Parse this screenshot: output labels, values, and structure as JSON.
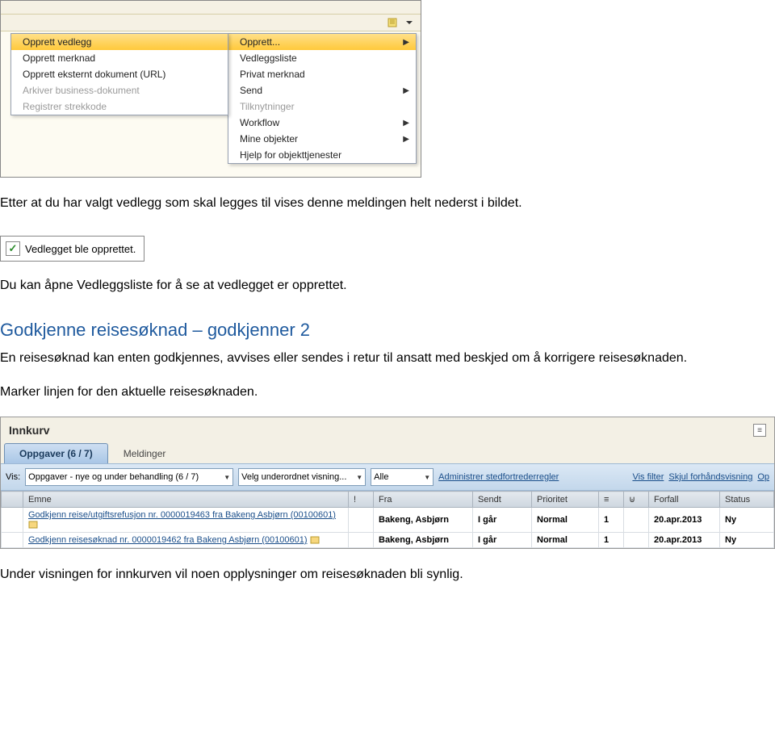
{
  "context_menu_left": {
    "items": [
      {
        "label": "Opprett vedlegg",
        "enabled": true,
        "highlight": true
      },
      {
        "label": "Opprett merknad",
        "enabled": true
      },
      {
        "label": "Opprett eksternt dokument (URL)",
        "enabled": true
      },
      {
        "label": "Arkiver business-dokument",
        "enabled": false
      },
      {
        "label": "Registrer strekkode",
        "enabled": false
      }
    ]
  },
  "context_menu_right": {
    "items": [
      {
        "label": "Opprett...",
        "enabled": true,
        "submenu": true,
        "highlight": true
      },
      {
        "label": "Vedleggsliste",
        "enabled": true
      },
      {
        "label": "Privat merknad",
        "enabled": true
      },
      {
        "label": "Send",
        "enabled": true,
        "submenu": true
      },
      {
        "label": "Tilknytninger",
        "enabled": false
      },
      {
        "label": "Workflow",
        "enabled": true,
        "submenu": true
      },
      {
        "label": "Mine objekter",
        "enabled": true,
        "submenu": true
      },
      {
        "label": "Hjelp for objekttjenester",
        "enabled": true
      }
    ]
  },
  "status_message": {
    "text": "Vedlegget ble opprettet."
  },
  "body_text": {
    "after_menu": "Etter at du har valgt vedlegg som skal legges til vises denne meldingen helt nederst i bildet.",
    "after_status": "Du kan åpne Vedleggsliste for å se at vedlegget er opprettet.",
    "heading": "Godkjenne reisesøknad – godkjenner 2",
    "p1": "En reisesøknad kan enten godkjennes, avvises eller sendes i retur til ansatt med beskjed om å korrigere reisesøknaden.",
    "p2": "Marker linjen for den aktuelle reisesøknaden.",
    "after_innkurv": "Under visningen for innkurven vil noen opplysninger om reisesøknaden bli synlig."
  },
  "innkurv": {
    "title": "Innkurv",
    "tabs": [
      {
        "label": "Oppgaver  (6 / 7)",
        "active": true
      },
      {
        "label": "Meldinger"
      }
    ],
    "filter": {
      "vis_label": "Vis:",
      "select1": "Oppgaver - nye og under behandling  (6 / 7)",
      "select2": "Velg underordnet visning...",
      "select3": "Alle",
      "link1": "Administrer stedfortrederregler",
      "link2": "Vis filter",
      "link3": "Skjul forhåndsvisning",
      "link4": "Op"
    },
    "columns": [
      "Emne",
      "!",
      "Fra",
      "Sendt",
      "Prioritet",
      "≡",
      "⊍",
      "Forfall",
      "Status"
    ],
    "rows": [
      {
        "emne": "Godkjenn reise/utgiftsrefusjon nr. 0000019463 fra Bakeng Asbjørn (00100601)",
        "fra": "Bakeng, Asbjørn",
        "sendt": "I går",
        "prioritet": "Normal",
        "sortnum": "1",
        "forfall": "20.apr.2013",
        "status": "Ny"
      },
      {
        "emne": "Godkjenn reisesøknad nr. 0000019462 fra Bakeng Asbjørn (00100601)",
        "fra": "Bakeng, Asbjørn",
        "sendt": "I går",
        "prioritet": "Normal",
        "sortnum": "1",
        "forfall": "20.apr.2013",
        "status": "Ny"
      }
    ]
  }
}
